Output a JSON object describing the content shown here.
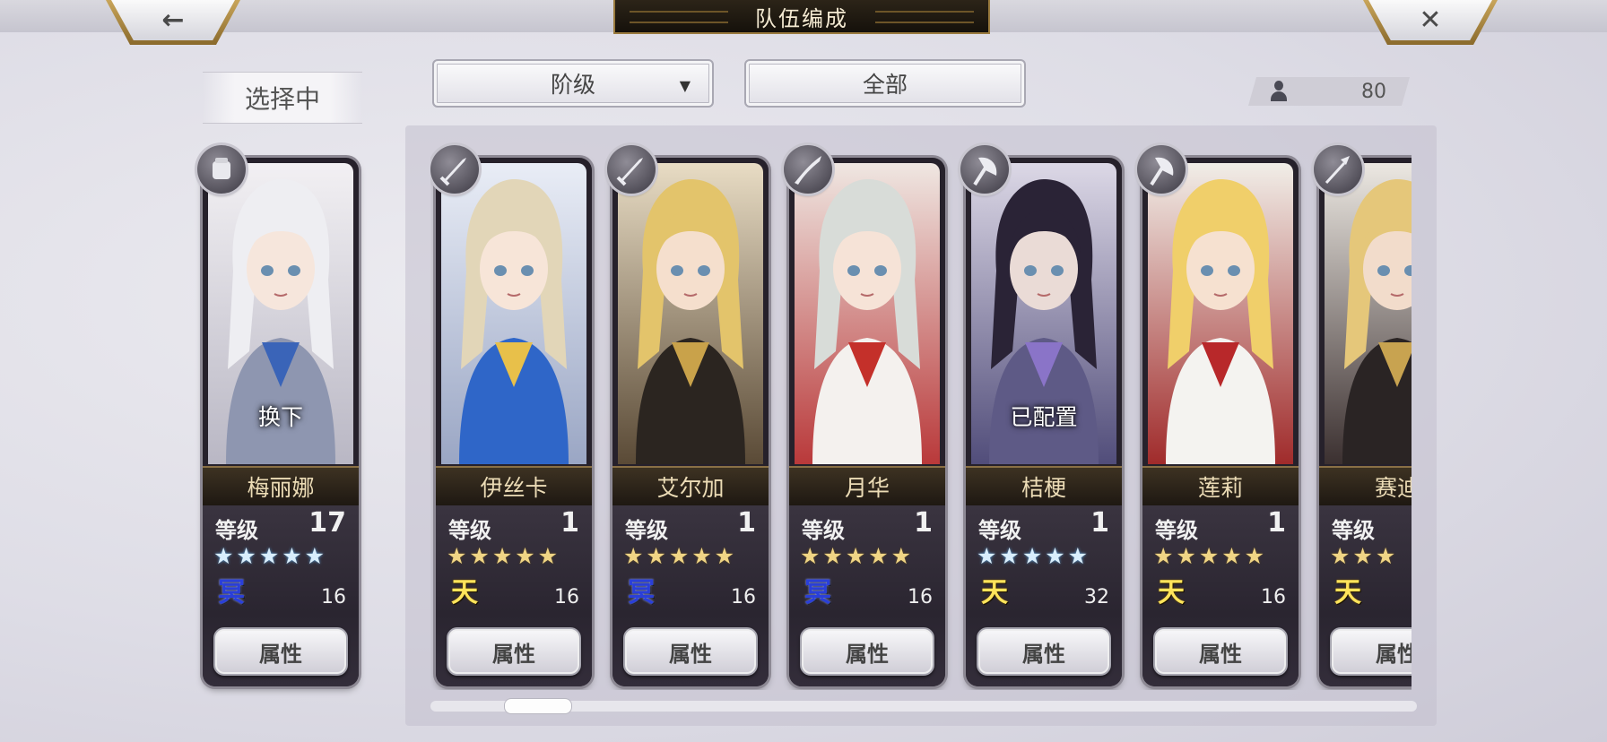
{
  "header": {
    "title": "队伍编成",
    "back_icon": "←",
    "close_icon": "✕"
  },
  "selecting_label": "选择中",
  "filters": {
    "rank_label": "阶级",
    "rank_arrow": "▼",
    "all_label": "全部"
  },
  "party_count": "80",
  "selected": {
    "name": "梅丽娜",
    "level_label": "等级",
    "level": "17",
    "stars": "★★★★★",
    "star_color": "blue",
    "element": "冥",
    "element_type": "nether",
    "cost": "16",
    "overlay": "换下",
    "attr_label": "属性",
    "weapon_icon": "gauntlet-icon"
  },
  "roster": [
    {
      "name": "伊丝卡",
      "level_label": "等级",
      "level": "1",
      "stars": "★★★★★",
      "star_color": "gold",
      "element": "天",
      "element_type": "heaven",
      "cost": "16",
      "overlay": "",
      "attr_label": "属性",
      "weapon_icon": "sword-icon"
    },
    {
      "name": "艾尔加",
      "level_label": "等级",
      "level": "1",
      "stars": "★★★★★",
      "star_color": "gold",
      "element": "冥",
      "element_type": "nether",
      "cost": "16",
      "overlay": "",
      "attr_label": "属性",
      "weapon_icon": "sword-icon"
    },
    {
      "name": "月华",
      "level_label": "等级",
      "level": "1",
      "stars": "★★★★★",
      "star_color": "gold",
      "element": "冥",
      "element_type": "nether",
      "cost": "16",
      "overlay": "",
      "attr_label": "属性",
      "weapon_icon": "katana-icon"
    },
    {
      "name": "桔梗",
      "level_label": "等级",
      "level": "1",
      "stars": "★★★★★",
      "star_color": "blue",
      "element": "天",
      "element_type": "heaven",
      "cost": "32",
      "overlay": "已配置",
      "attr_label": "属性",
      "weapon_icon": "axe-icon"
    },
    {
      "name": "莲莉",
      "level_label": "等级",
      "level": "1",
      "stars": "★★★★★",
      "star_color": "gold",
      "element": "天",
      "element_type": "heaven",
      "cost": "16",
      "overlay": "",
      "attr_label": "属性",
      "weapon_icon": "axe-icon"
    },
    {
      "name": "赛迪",
      "level_label": "等级",
      "level": "",
      "stars": "★★★",
      "star_color": "gold",
      "element": "天",
      "element_type": "heaven",
      "cost": "",
      "overlay": "",
      "attr_label": "属性",
      "weapon_icon": "spear-icon"
    }
  ],
  "palette": {
    "heaven": "#ffe45b",
    "nether": "#2a3fd8",
    "gold_star": "#f0d585",
    "blue_star": "#d9eefc",
    "nameplate_text": "#ecdcb6"
  }
}
